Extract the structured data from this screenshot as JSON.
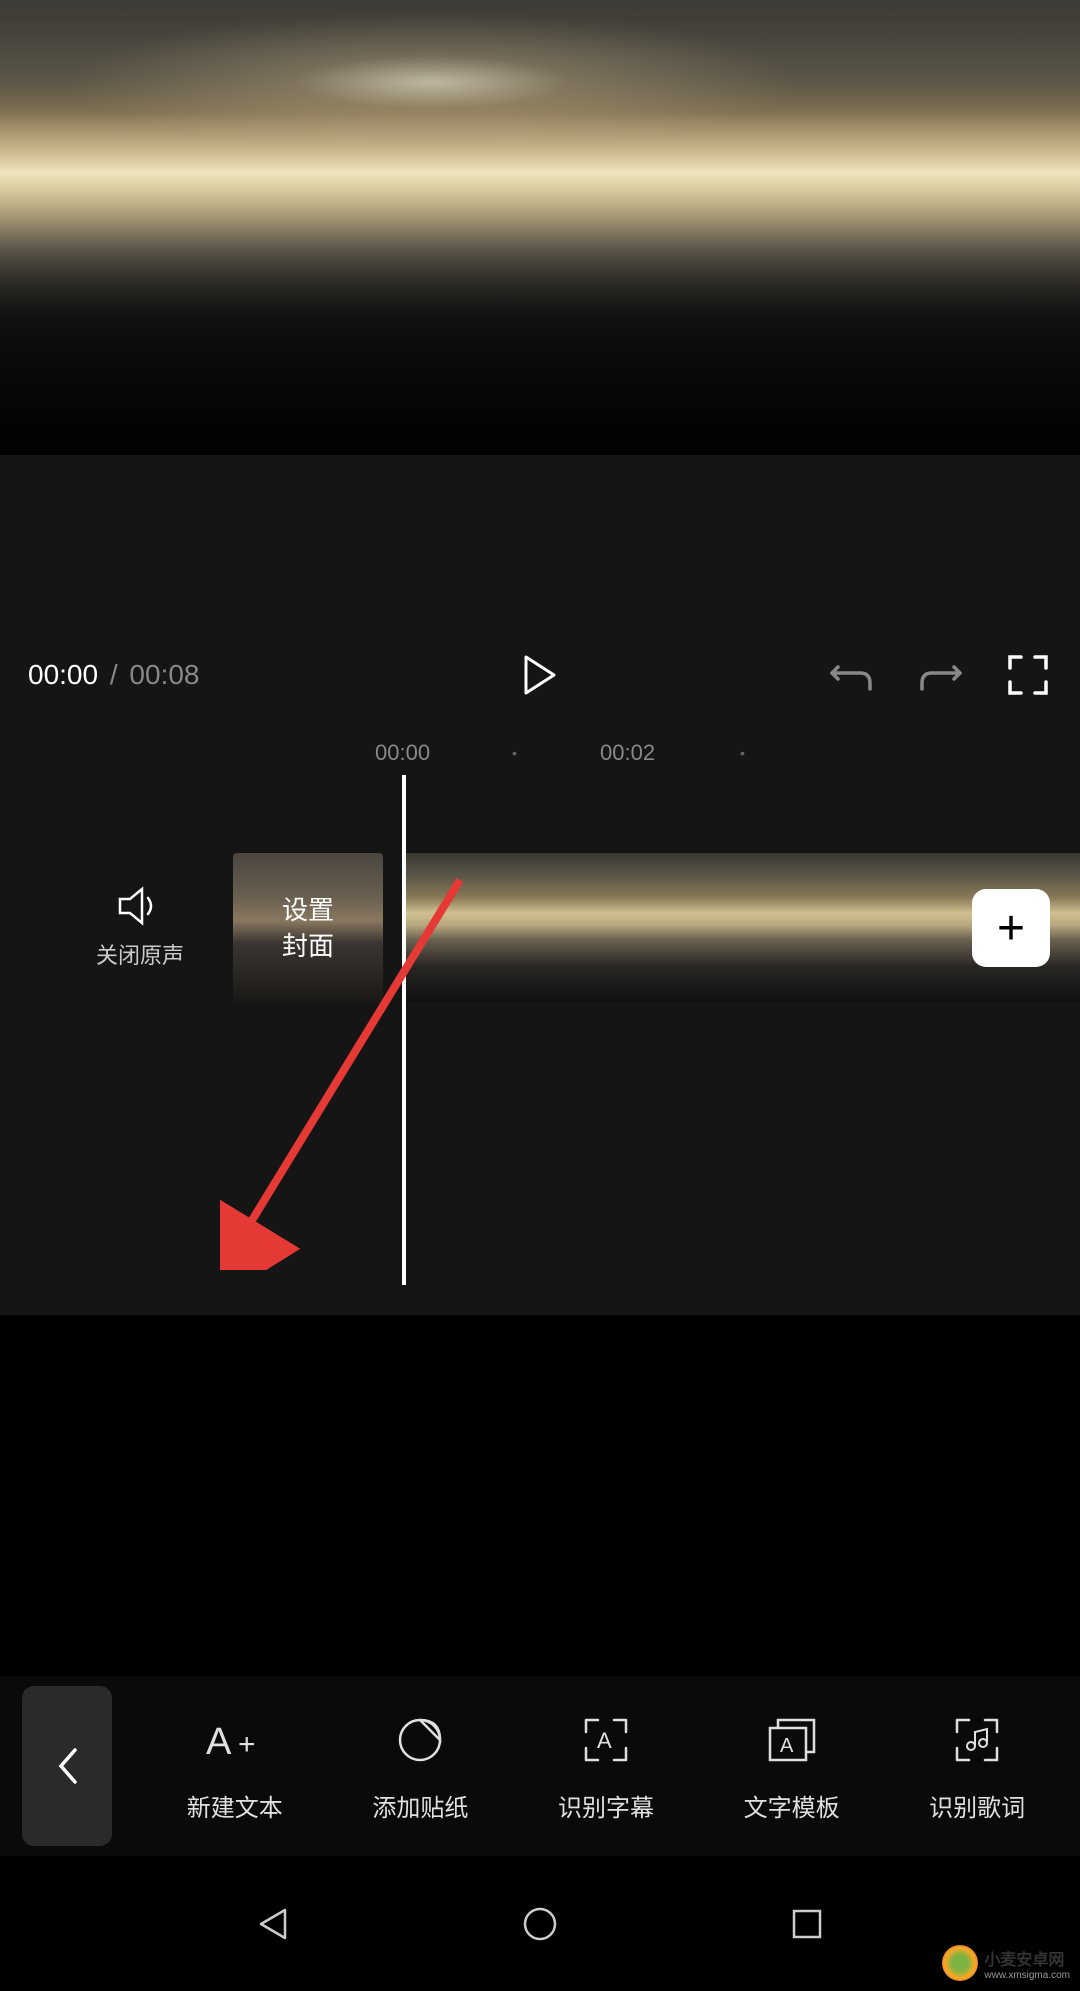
{
  "player": {
    "current_time": "00:00",
    "separator": "/",
    "total_time": "00:08"
  },
  "timeline": {
    "marks": [
      "00:00",
      "00:02"
    ],
    "mute_label": "关闭原声",
    "cover_label_line1": "设置",
    "cover_label_line2": "封面",
    "add_label": "+"
  },
  "toolbar": {
    "items": [
      {
        "icon": "text-add",
        "label": "新建文本"
      },
      {
        "icon": "sticker",
        "label": "添加贴纸"
      },
      {
        "icon": "subtitle",
        "label": "识别字幕"
      },
      {
        "icon": "text-template",
        "label": "文字模板"
      },
      {
        "icon": "lyrics",
        "label": "识别歌词"
      }
    ]
  },
  "watermark": {
    "title": "小麦安卓网",
    "url": "www.xmsigma.com"
  }
}
